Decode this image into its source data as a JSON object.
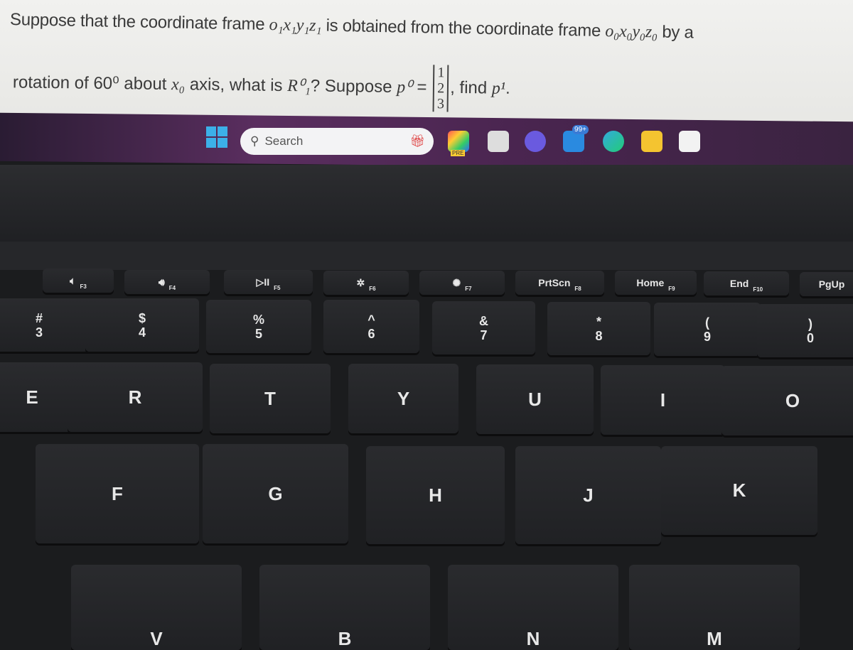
{
  "question": {
    "line1_pre": "Suppose that the coordinate frame ",
    "frame1": "o₁x₁y₁z₁",
    "line1_mid": " is obtained from the coordinate frame ",
    "frame0": "o₀x₀y₀z₀",
    "line1_post": " by a",
    "line2_pre": "rotation of 60⁰ about ",
    "axis": "x₀",
    "line2_mid": " axis, what is ",
    "rot": "R⁰₁",
    "line2_mid2": "? Suppose ",
    "p0": "p⁰",
    "eq": " = ",
    "vector": [
      "1",
      "2",
      "3"
    ],
    "line2_post": ", find ",
    "p1": "p¹",
    "end": "."
  },
  "taskbar": {
    "search_placeholder": "Search",
    "copilot_badge": "PRE",
    "mail_badge": "99+"
  },
  "keyboard": {
    "fn_row": [
      {
        "icon": "mute-icon",
        "glyph": "🔈︎",
        "fn": "F3"
      },
      {
        "icon": "volume-icon",
        "glyph": "🔊︎",
        "fn": "F4"
      },
      {
        "icon": "play-pause-icon",
        "glyph": "▷II",
        "fn": "F5"
      },
      {
        "icon": "brightness-down-icon",
        "glyph": "✲",
        "fn": "F6"
      },
      {
        "icon": "brightness-up-icon",
        "glyph": "✺",
        "fn": "F7"
      },
      {
        "label": "PrtScn",
        "fn": "F8"
      },
      {
        "label": "Home",
        "fn": "F9"
      },
      {
        "label": "End",
        "fn": "F10"
      },
      {
        "label": "PgUp",
        "fn": ""
      }
    ],
    "num_row": [
      [
        "#",
        "3"
      ],
      [
        "$",
        "4"
      ],
      [
        "%",
        "5"
      ],
      [
        "^",
        "6"
      ],
      [
        "&",
        "7"
      ],
      [
        "*",
        "8"
      ],
      [
        "(",
        "9"
      ],
      [
        ")",
        "0"
      ]
    ],
    "qwerty_row": [
      "E",
      "R",
      "T",
      "Y",
      "U",
      "I",
      "O"
    ],
    "home_row": [
      "F",
      "G",
      "H",
      "J",
      "K"
    ],
    "bottom_row": [
      "V",
      "B",
      "N",
      "M"
    ]
  }
}
